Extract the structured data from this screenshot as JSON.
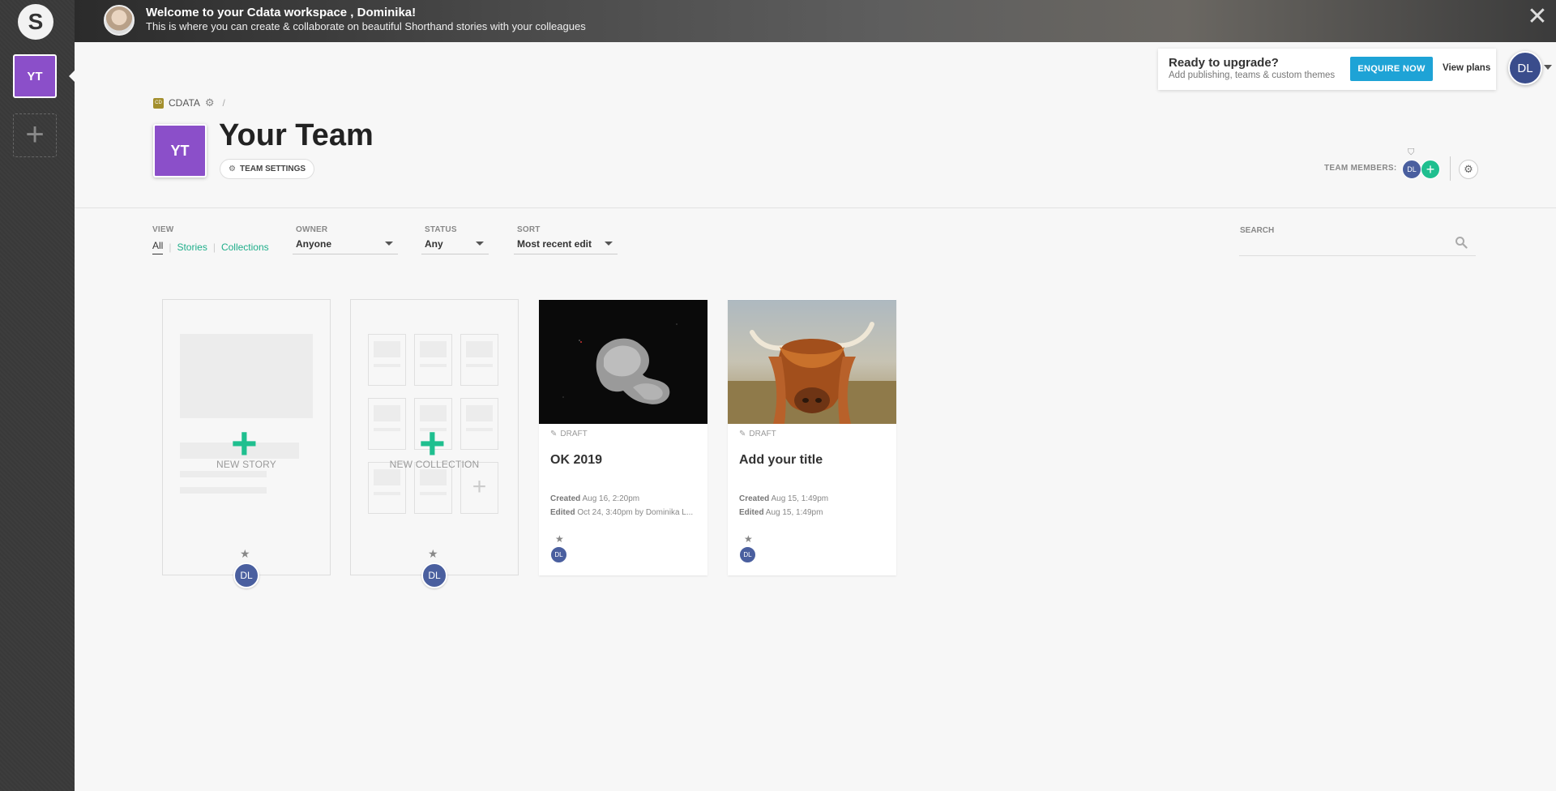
{
  "rail": {
    "logo_letter": "S",
    "team_initials": "YT",
    "add_symbol": "+"
  },
  "banner": {
    "title": "Welcome to your Cdata workspace , Dominika!",
    "subtitle": "This is where you can create & collaborate on beautiful Shorthand stories with your colleagues",
    "close_symbol": "✕"
  },
  "upgrade": {
    "title": "Ready to upgrade?",
    "subtitle": "Add publishing, teams & custom themes",
    "enquire_label": "ENQUIRE NOW",
    "view_plans_label": "View plans"
  },
  "user": {
    "initials": "DL"
  },
  "breadcrumb": {
    "workspace_badge": "CD",
    "workspace": "CDATA",
    "separator": "/"
  },
  "team": {
    "initials": "YT",
    "title": "Your Team",
    "settings_label": "TEAM SETTINGS",
    "members_label": "TEAM MEMBERS:",
    "member_initials": "DL",
    "add_member_symbol": "+"
  },
  "filters": {
    "view_label": "VIEW",
    "view_all": "All",
    "view_stories": "Stories",
    "view_collections": "Collections",
    "owner_label": "OWNER",
    "owner_value": "Anyone",
    "status_label": "STATUS",
    "status_value": "Any",
    "sort_label": "SORT",
    "sort_value": "Most recent edit",
    "search_label": "SEARCH"
  },
  "cards": {
    "new_story_label": "NEW STORY",
    "new_collection_label": "NEW COLLECTION",
    "new_story_owner": "DL",
    "new_collection_owner": "DL",
    "stories": [
      {
        "status": "DRAFT",
        "title": "OK 2019",
        "created_label": "Created",
        "created": "Aug 16, 2:20pm",
        "edited_label": "Edited",
        "edited": "Oct 24, 3:40pm by Dominika L...",
        "owner": "DL"
      },
      {
        "status": "DRAFT",
        "title": "Add your title",
        "created_label": "Created",
        "created": "Aug 15, 1:49pm",
        "edited_label": "Edited",
        "edited": "Aug 15, 1:49pm",
        "owner": "DL"
      }
    ]
  },
  "colors": {
    "team_purple": "#8b4fc9",
    "accent_green": "#1fbf8f",
    "enquire_blue": "#1ea3d6",
    "avatar_blue": "#4a5f9f"
  }
}
